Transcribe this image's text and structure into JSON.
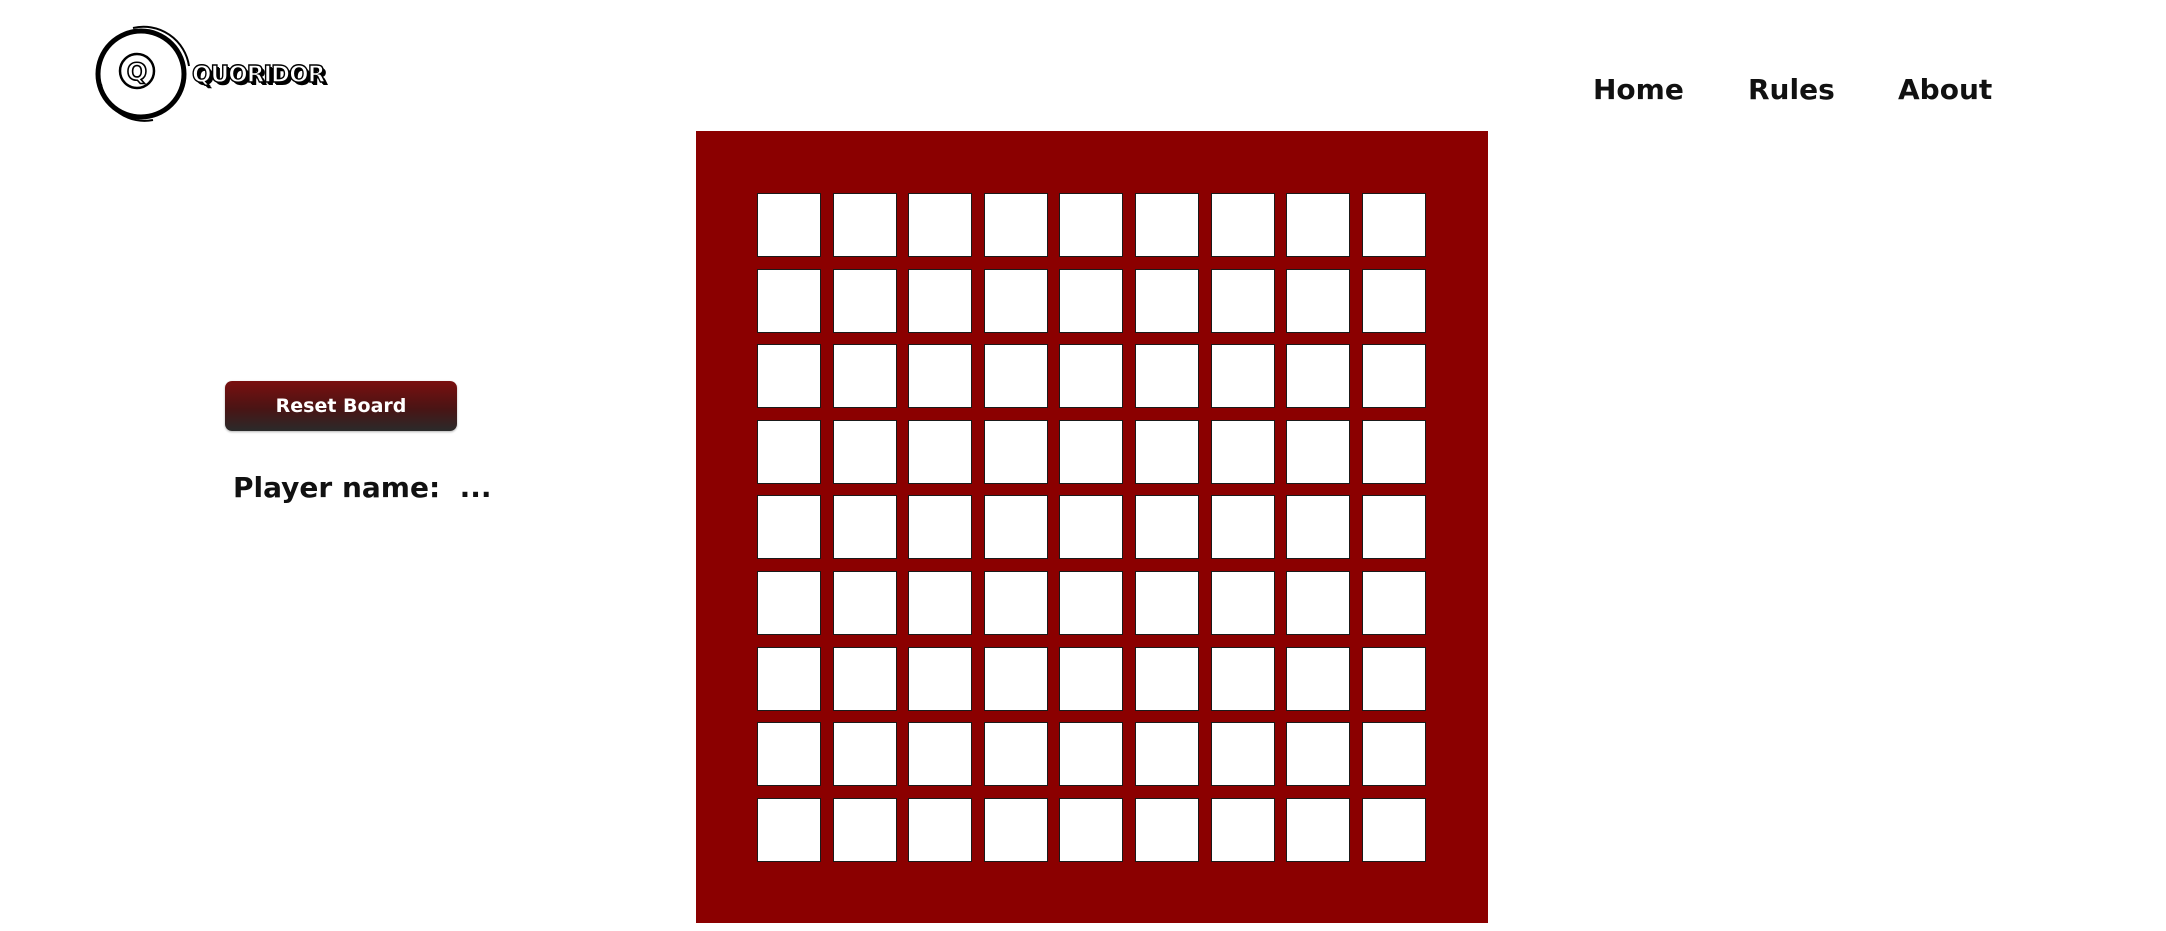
{
  "logo": {
    "text": "QUORIDOR",
    "letter": "Q"
  },
  "nav": {
    "home": "Home",
    "rules": "Rules",
    "about": "About"
  },
  "controls": {
    "reset_label": "Reset Board",
    "player_label": "Player name:",
    "player_value": "..."
  },
  "board": {
    "rows": 9,
    "cols": 9,
    "frame_color": "#8b0000",
    "cell_color": "#ffffff"
  }
}
